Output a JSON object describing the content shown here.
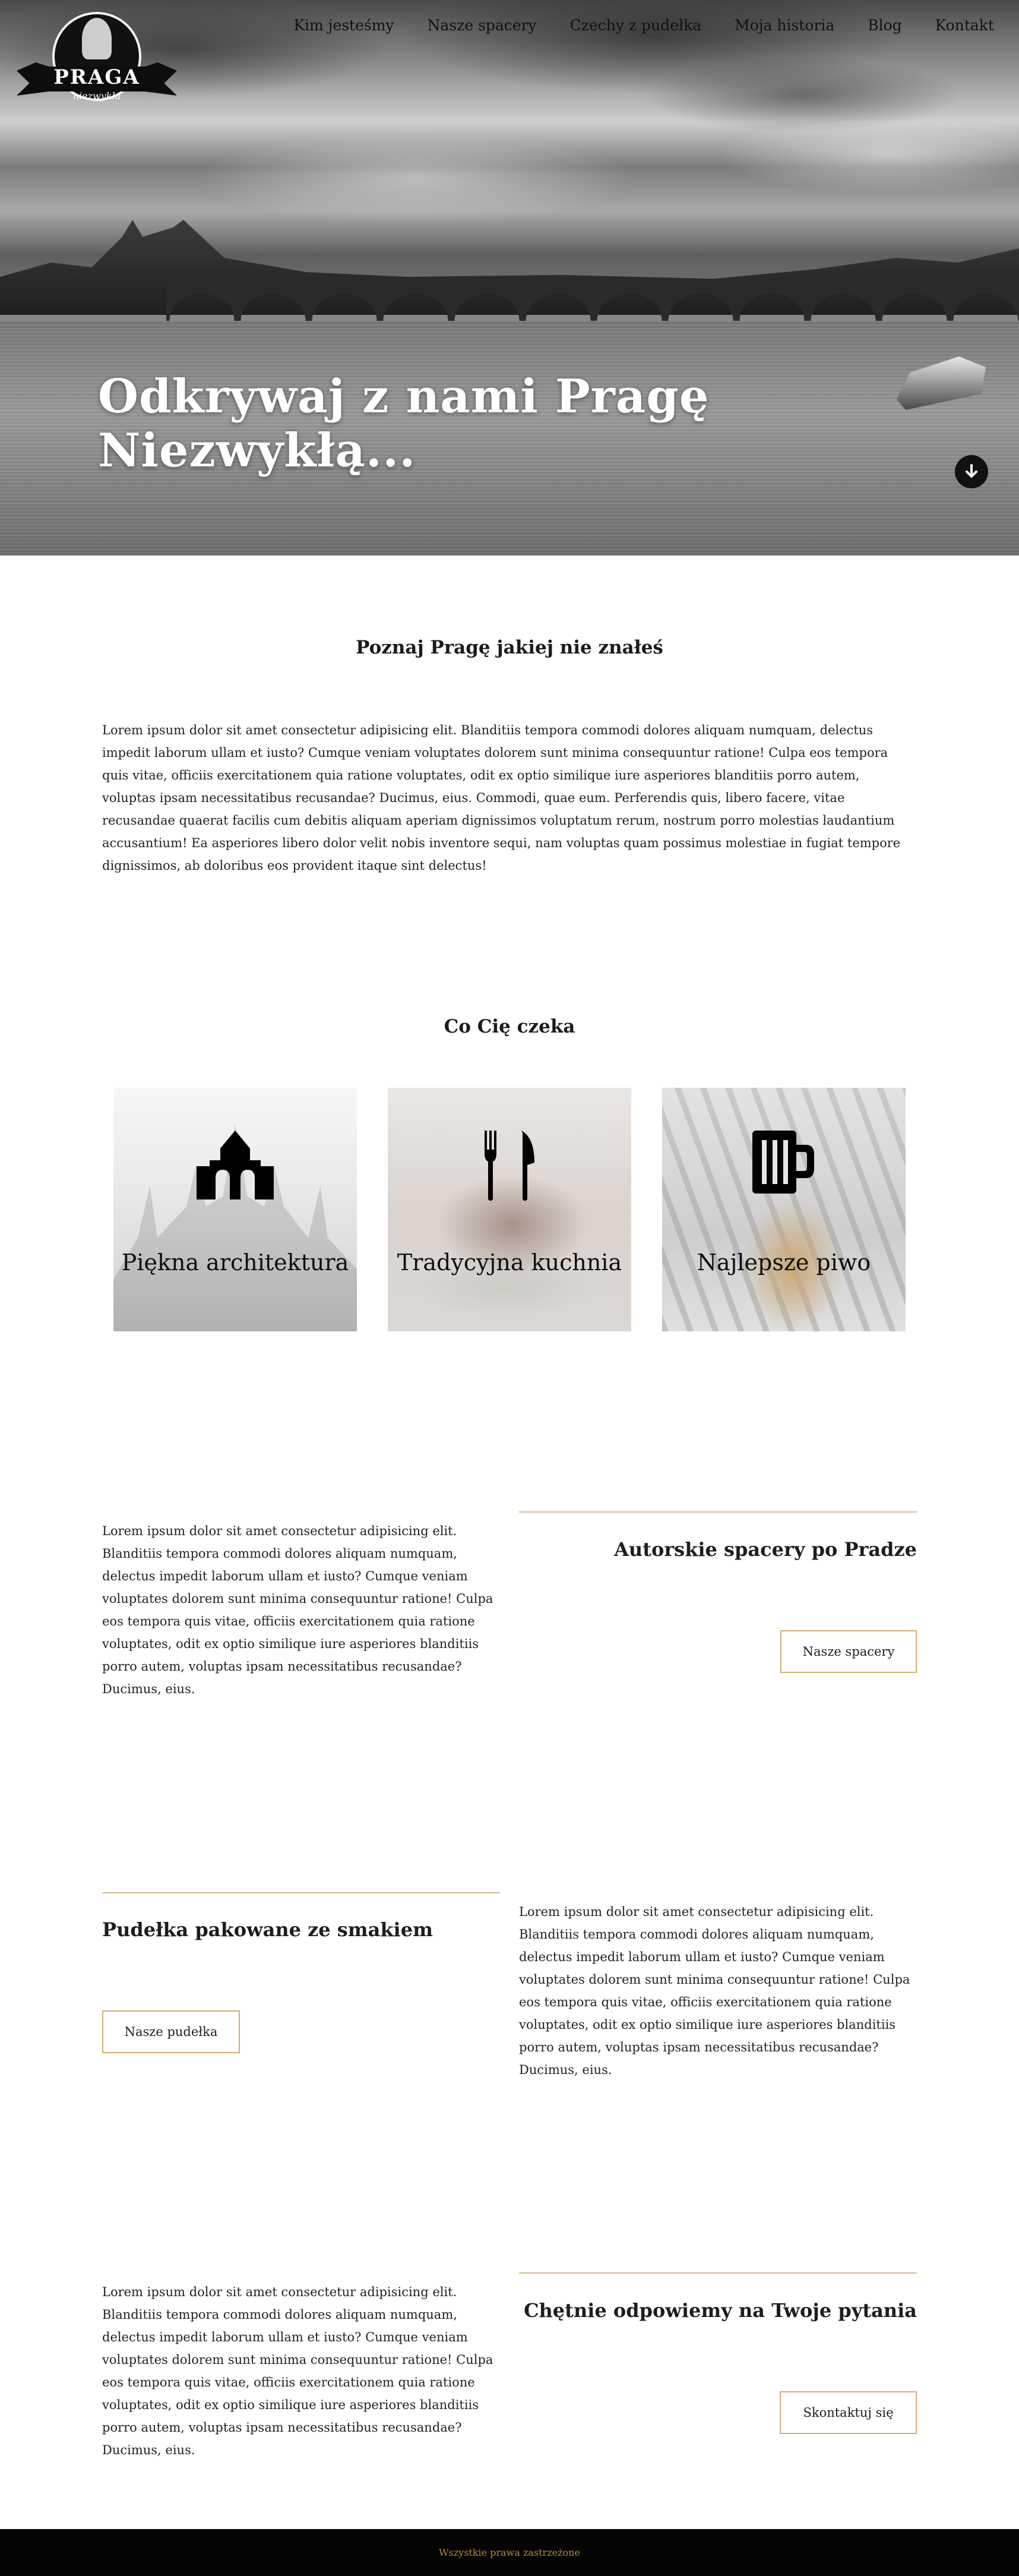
{
  "brand": {
    "name": "PRAGA",
    "tagline": "niezwykła"
  },
  "nav": {
    "items": [
      "Kim jesteśmy",
      "Nasze spacery",
      "Czechy z pudełka",
      "Moja historia",
      "Blog",
      "Kontakt"
    ]
  },
  "hero": {
    "headline": "Odkrywaj z nami Pragę Niezwykłą...",
    "scroll_icon": "arrow-down-circle-icon"
  },
  "intro": {
    "title": "Poznaj Pragę jakiej nie znałeś",
    "text": "Lorem ipsum dolor sit amet consectetur adipisicing elit. Blanditiis tempora commodi dolores aliquam numquam, delectus impedit laborum ullam et iusto? Cumque veniam voluptates dolorem sunt minima consequuntur ratione! Culpa eos tempora quis vitae, officiis exercitationem quia ratione voluptates, odit ex optio similique iure asperiores blanditiis porro autem, voluptas ipsam necessitatibus recusandae? Ducimus, eius. Commodi, quae eum. Perferendis quis, libero facere, vitae recusandae quaerat facilis cum debitis aliquam aperiam dignissimos voluptatum rerum, nostrum porro molestias laudantium accusantium! Ea asperiores libero dolor velit nobis inventore sequi, nam voluptas quam possimus molestiae in fugiat tempore dignissimos, ab doloribus eos provident itaque sint delectus!"
  },
  "features": {
    "title": "Co Cię czeka",
    "cards": [
      {
        "label": "Piękna architektura",
        "icon": "church-icon"
      },
      {
        "label": "Tradycyjna kuchnia",
        "icon": "fork-knife-icon"
      },
      {
        "label": "Najlepsze piwo",
        "icon": "beer-mug-icon"
      }
    ]
  },
  "sections": {
    "walks": {
      "heading": "Autorskie spacery po Pradze",
      "text": "Lorem ipsum dolor sit amet consectetur adipisicing elit. Blanditiis tempora commodi dolores aliquam numquam, delectus impedit laborum ullam et iusto? Cumque veniam voluptates dolorem sunt minima consequuntur ratione! Culpa eos tempora quis vitae, officiis exercitationem quia ratione voluptates, odit ex optio similique iure asperiores blanditiis porro autem, voluptas ipsam necessitatibus recusandae? Ducimus, eius.",
      "button": "Nasze spacery"
    },
    "boxes": {
      "heading": "Pudełka pakowane ze smakiem",
      "text": "Lorem ipsum dolor sit amet consectetur adipisicing elit. Blanditiis tempora commodi dolores aliquam numquam, delectus impedit laborum ullam et iusto? Cumque veniam voluptates dolorem sunt minima consequuntur ratione! Culpa eos tempora quis vitae, officiis exercitationem quia ratione voluptates, odit ex optio similique iure asperiores blanditiis porro autem, voluptas ipsam necessitatibus recusandae? Ducimus, eius.",
      "button": "Nasze pudełka"
    },
    "contact": {
      "heading": "Chętnie odpowiemy na Twoje pytania",
      "text": "Lorem ipsum dolor sit amet consectetur adipisicing elit. Blanditiis tempora commodi dolores aliquam numquam, delectus impedit laborum ullam et iusto? Cumque veniam voluptates dolorem sunt minima consequuntur ratione! Culpa eos tempora quis vitae, officiis exercitationem quia ratione voluptates, odit ex optio similique iure asperiores blanditiis porro autem, voluptas ipsam necessitatibus recusandae? Ducimus, eius.",
      "button": "Skontaktuj się"
    }
  },
  "footer": {
    "text": "Wszystkie prawa zastrzeżone"
  },
  "colors": {
    "accent": "#d7ac6e",
    "footer_bg": "#050505",
    "footer_text": "#b98a36"
  }
}
